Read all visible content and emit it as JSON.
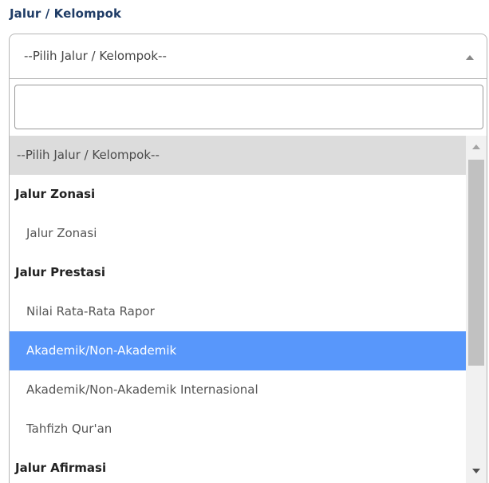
{
  "field": {
    "label": "Jalur / Kelompok"
  },
  "select": {
    "selected_text": "--Pilih Jalur / Kelompok--"
  },
  "search": {
    "value": "",
    "placeholder": ""
  },
  "options": [
    {
      "label": "--Pilih Jalur / Kelompok--",
      "kind": "placeholder",
      "highlighted": false
    },
    {
      "label": "Jalur Zonasi",
      "kind": "group",
      "highlighted": false
    },
    {
      "label": "Jalur Zonasi",
      "kind": "option",
      "highlighted": false
    },
    {
      "label": "Jalur Prestasi",
      "kind": "group",
      "highlighted": false
    },
    {
      "label": "Nilai Rata-Rata Rapor",
      "kind": "option",
      "highlighted": false
    },
    {
      "label": "Akademik/Non-Akademik",
      "kind": "option",
      "highlighted": true
    },
    {
      "label": "Akademik/Non-Akademik Internasional",
      "kind": "option",
      "highlighted": false
    },
    {
      "label": "Tahfizh Qur'an",
      "kind": "option",
      "highlighted": false
    },
    {
      "label": "Jalur Afirmasi",
      "kind": "group",
      "highlighted": false
    }
  ],
  "icons": {
    "select_arrow": "caret-up-icon",
    "scroll_up": "scroll-up-arrow-icon",
    "scroll_down": "scroll-down-arrow-icon"
  },
  "colors": {
    "label": "#1f3c66",
    "highlight": "#5897fb",
    "placeholder_bg": "#dcdcdc"
  }
}
